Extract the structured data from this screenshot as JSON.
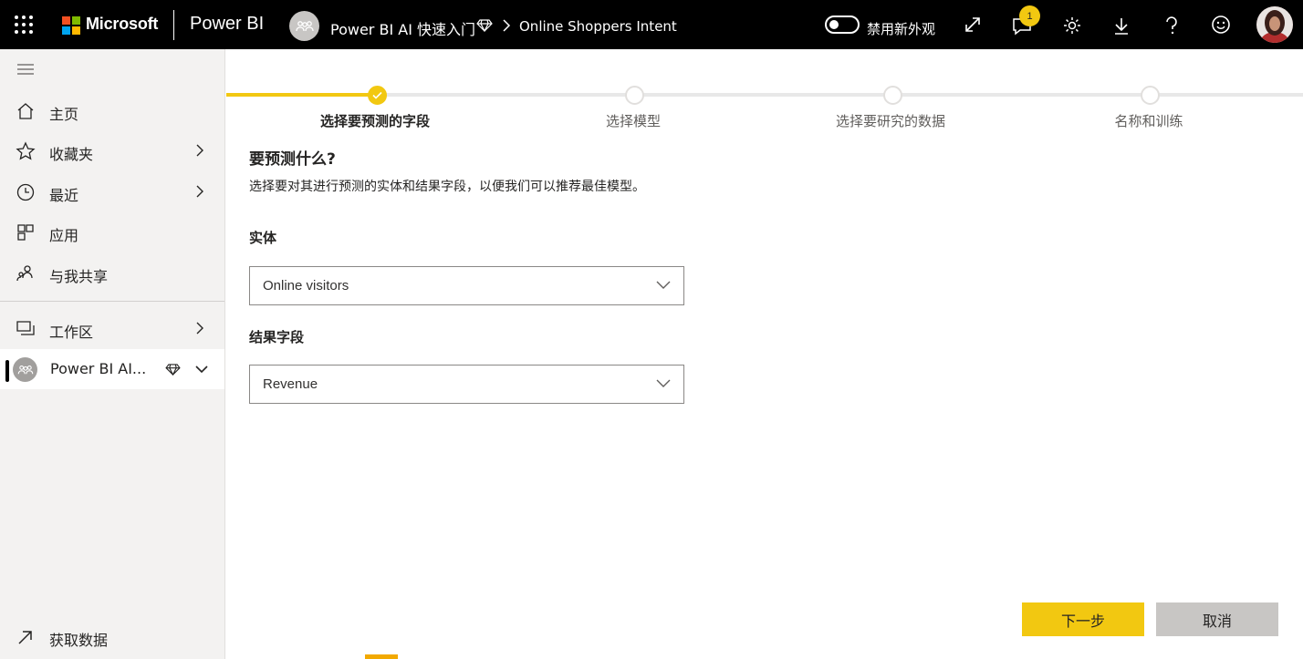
{
  "topbar": {
    "brand": "Microsoft",
    "product": "Power BI",
    "workspace": "Power BI AI 快速入门",
    "report": "Online Shoppers Intent",
    "toggle_label": "禁用新外观",
    "notification_count": "1",
    "icons": [
      "waffle-icon",
      "expand-icon",
      "notification-icon",
      "gear-icon",
      "download-icon",
      "help-icon",
      "feedback-icon"
    ]
  },
  "sidebar": {
    "items": [
      {
        "label": "主页",
        "icon": "home-icon"
      },
      {
        "label": "收藏夹",
        "icon": "star-icon"
      },
      {
        "label": "最近",
        "icon": "clock-icon"
      },
      {
        "label": "应用",
        "icon": "apps-icon"
      },
      {
        "label": "与我共享",
        "icon": "shared-icon"
      }
    ],
    "workspaces_label": "工作区",
    "active_workspace": "Power BI AI...",
    "get_data": "获取数据"
  },
  "wizard": {
    "steps": [
      {
        "label": "选择要预测的字段",
        "state": "done"
      },
      {
        "label": "选择模型",
        "state": "pending"
      },
      {
        "label": "选择要研究的数据",
        "state": "pending"
      },
      {
        "label": "名称和训练",
        "state": "pending"
      }
    ],
    "heading": "要预测什么?",
    "description": "选择要对其进行预测的实体和结果字段，以便我们可以推荐最佳模型。",
    "entity_label": "实体",
    "entity_value": "Online visitors",
    "outcome_label": "结果字段",
    "outcome_value": "Revenue",
    "next_label": "下一步",
    "cancel_label": "取消"
  },
  "colors": {
    "accent": "#f2c811",
    "topbar": "#000000",
    "sidebar": "#f3f2f1"
  }
}
